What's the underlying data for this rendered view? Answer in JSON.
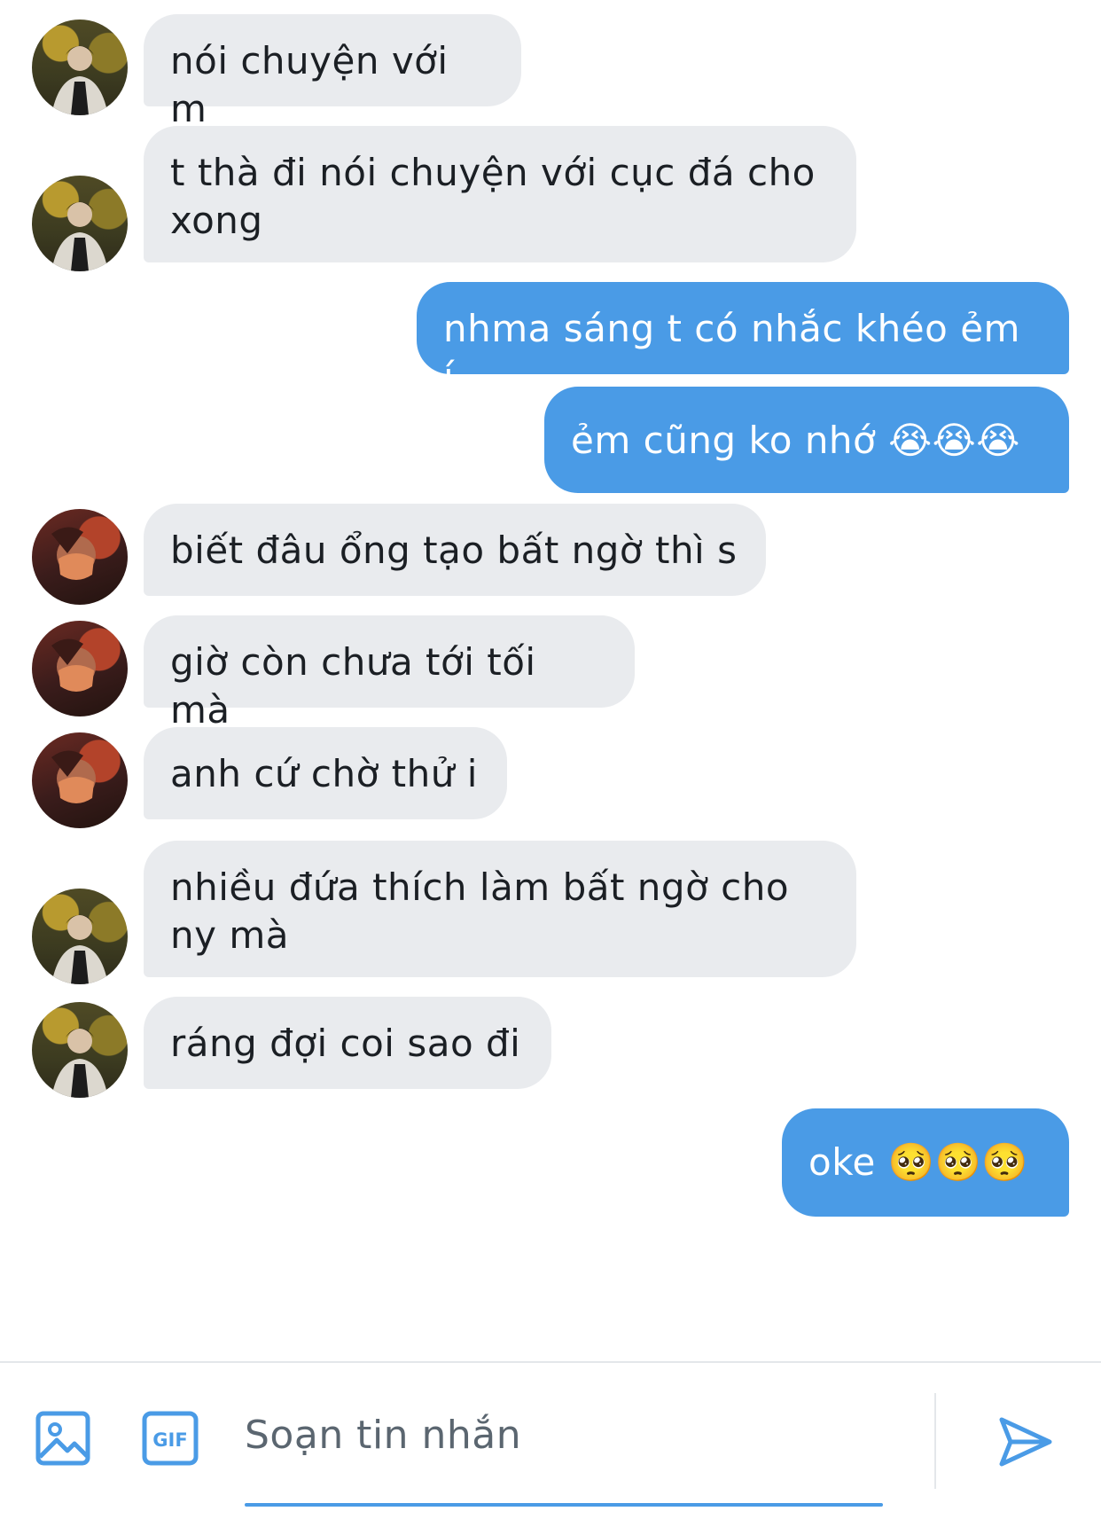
{
  "messages": [
    {
      "side": "in",
      "avatar": "a",
      "text": "nói chuyện với m"
    },
    {
      "side": "in",
      "avatar": "a",
      "text": "t thà đi nói chuyện với cục đá cho xong"
    },
    {
      "side": "out",
      "text": "nhma sáng t có nhắc khéo ẻm í"
    },
    {
      "side": "out",
      "text": "ẻm cũng ko nhớ 😭😭😭"
    },
    {
      "side": "in",
      "avatar": "b",
      "text": "biết đâu ổng tạo bất ngờ thì s"
    },
    {
      "side": "in",
      "avatar": "b",
      "text": "giờ còn chưa tới tối mà"
    },
    {
      "side": "in",
      "avatar": "b",
      "text": "anh cứ chờ thử i"
    },
    {
      "side": "in",
      "avatar": "a",
      "text": "nhiều đứa thích làm bất ngờ cho ny mà"
    },
    {
      "side": "in",
      "avatar": "a",
      "text": "ráng đợi coi sao đi"
    },
    {
      "side": "out",
      "text": "oke 🥺🥺🥺"
    }
  ],
  "composer": {
    "placeholder": "Soạn tin nhắn",
    "gif_label": "GIF",
    "image_icon": "image-icon",
    "gif_icon": "gif-icon",
    "send_icon": "send-icon"
  },
  "colors": {
    "accent": "#4a9be6",
    "incoming_bubble": "#e9ebee",
    "incoming_text": "#1b1f24",
    "outgoing_text": "#ffffff"
  }
}
